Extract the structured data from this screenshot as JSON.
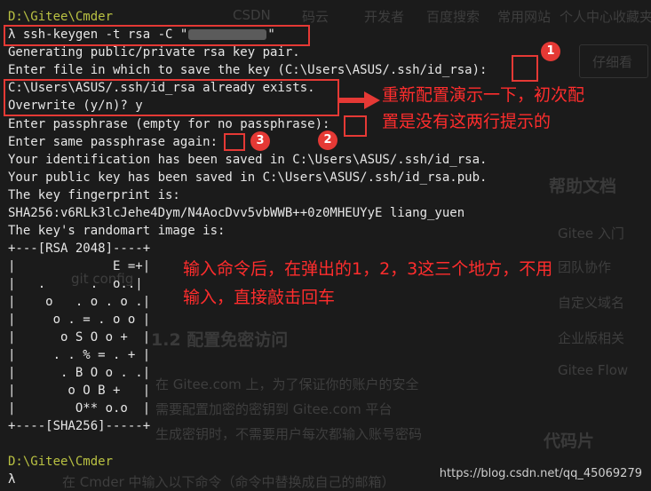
{
  "terminal": {
    "lines": [
      {
        "prompt": "D:\\Gitee\\Cmder"
      },
      {
        "lambda": "λ",
        "cmd_before": "ssh-keygen -t rsa -C \"",
        "cmd_after": "\""
      },
      {
        "text": "Generating public/private rsa key pair."
      },
      {
        "text": "Enter file in which to save the key (C:\\Users\\ASUS/.ssh/id_rsa):"
      },
      {
        "text": "C:\\Users\\ASUS/.ssh/id_rsa already exists."
      },
      {
        "text": "Overwrite (y/n)? y"
      },
      {
        "text": "Enter passphrase (empty for no passphrase):"
      },
      {
        "text": "Enter same passphrase again:"
      },
      {
        "text": "Your identification has been saved in C:\\Users\\ASUS/.ssh/id_rsa."
      },
      {
        "text": "Your public key has been saved in C:\\Users\\ASUS/.ssh/id_rsa.pub."
      },
      {
        "text": "The key fingerprint is:"
      },
      {
        "text": "SHA256:v6RLk3lcJehe4Dym/N4AocDvv5vbWWB++0z0MHEUYyE liang_yuen"
      },
      {
        "text": "The key's randomart image is:"
      },
      {
        "text": "+---[RSA 2048]----+"
      },
      {
        "text": "|             E =+|"
      },
      {
        "text": "|   .      .  o..|"
      },
      {
        "text": "|    o   . o . o .|"
      },
      {
        "text": "|     o . = . o o |"
      },
      {
        "text": "|      o S O o +  |"
      },
      {
        "text": "|     . . % = . + |"
      },
      {
        "text": "|      . B O o . .|"
      },
      {
        "text": "|       o O B +   |"
      },
      {
        "text": "|        O** o.o  |"
      },
      {
        "text": "+----[SHA256]-----+"
      },
      {
        "text": ""
      },
      {
        "prompt": "D:\\Gitee\\Cmder"
      },
      {
        "lambda": "λ"
      }
    ]
  },
  "annotations": {
    "badges": [
      "1",
      "2",
      "3"
    ],
    "note_1_line1": "重新配置演示一下，初次配",
    "note_1_line2": "置是没有这两行提示的",
    "note_2_line1": "输入命令后，在弹出的1，2，3这三个地方，不用",
    "note_2_line2": "输入，直接敲击回车"
  },
  "background": {
    "bookmarks": [
      "CSDN",
      "码云",
      "开发者",
      "百度搜索",
      "常用网站",
      "个人中心",
      "收藏夹"
    ],
    "right_button": "仔细看",
    "help_title": "帮助文档",
    "help_items": [
      "Gitee 入门",
      "团队协作",
      "自定义域名",
      "企业版相关",
      "Gitee Flow"
    ],
    "section_heading": "1.2 配置免密访问",
    "body_text_1": "在 Gitee.com 上，为了保证你的账户的安全",
    "body_text_2": "需要配置加密的密钥到 Gitee.com 平台",
    "body_text_3": "生成密钥时，不需要用户每次都输入账号密码",
    "code_heading": "代码片",
    "footer_text": "在 Cmder 中输入以下命令（命令中替换成自己的邮箱）",
    "git_config": "git config"
  },
  "watermark": "https://blog.csdn.net/qq_45069279",
  "colors": {
    "accent_red": "#e53935",
    "prompt_yellow": "#b9c142",
    "terminal_bg": "#1b1b1b"
  }
}
